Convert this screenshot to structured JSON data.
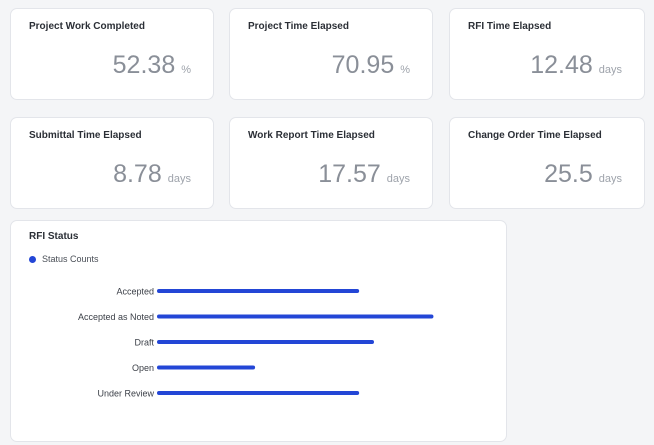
{
  "kpis": [
    {
      "title": "Project Work Completed",
      "value": "52.38",
      "unit": "%"
    },
    {
      "title": "Project Time Elapsed",
      "value": "70.95",
      "unit": "%"
    },
    {
      "title": "RFI Time Elapsed",
      "value": "12.48",
      "unit": "days"
    },
    {
      "title": "Submittal Time Elapsed",
      "value": "8.78",
      "unit": "days"
    },
    {
      "title": "Work Report Time Elapsed",
      "value": "17.57",
      "unit": "days"
    },
    {
      "title": "Change Order Time Elapsed",
      "value": "25.5",
      "unit": "days"
    }
  ],
  "rfi_status": {
    "title": "RFI Status",
    "legend": "Status Counts"
  },
  "colors": {
    "bar": "#2346d6",
    "legend_dot": "#2346d6"
  },
  "chart_data": {
    "type": "bar",
    "orientation": "horizontal",
    "title": "RFI Status",
    "categories": [
      "Accepted",
      "Accepted as Noted",
      "Draft",
      "Open",
      "Under Review"
    ],
    "series": [
      {
        "name": "Status Counts",
        "values": [
          4,
          5.5,
          4.3,
          1.9,
          4
        ]
      }
    ],
    "xlim": [
      0,
      6.5
    ],
    "grid": false,
    "legend_position": "top-left"
  }
}
